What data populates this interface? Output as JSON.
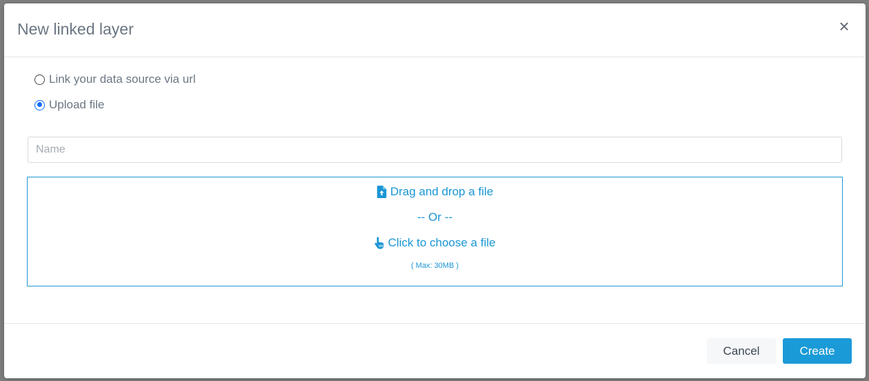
{
  "modal": {
    "title": "New linked layer",
    "close_glyph": "×"
  },
  "source_options": [
    {
      "label": "Link your data source via url",
      "checked": false
    },
    {
      "label": "Upload file",
      "checked": true
    }
  ],
  "name_field": {
    "value": "",
    "placeholder": "Name"
  },
  "dropzone": {
    "drag_label": "Drag and drop a file",
    "or_label": "-- Or --",
    "click_label": "Click to choose a file",
    "max_label": "( Max: 30MB )",
    "accent_color": "#1a96d4",
    "drag_icon": "file-upload-icon",
    "click_icon": "hand-pointer-icon"
  },
  "footer": {
    "cancel_label": "Cancel",
    "create_label": "Create",
    "primary_color": "#1a9bd7"
  }
}
